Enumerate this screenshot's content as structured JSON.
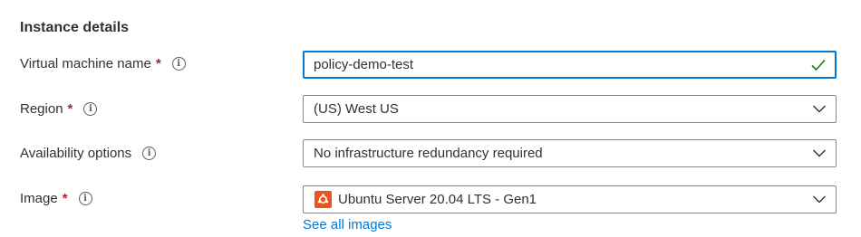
{
  "section": {
    "title": "Instance details"
  },
  "fields": {
    "vm_name": {
      "label": "Virtual machine name",
      "required_mark": "*",
      "value": "policy-demo-test"
    },
    "region": {
      "label": "Region",
      "required_mark": "*",
      "value": "(US) West US"
    },
    "availability": {
      "label": "Availability options",
      "value": "No infrastructure redundancy required"
    },
    "image": {
      "label": "Image",
      "required_mark": "*",
      "value": "Ubuntu Server 20.04 LTS - Gen1",
      "link": "See all images"
    }
  },
  "icons": {
    "info": "info-icon",
    "chevron": "chevron-down-icon",
    "valid": "checkmark-icon",
    "image_os": "ubuntu-icon"
  },
  "colors": {
    "accent": "#0078d4",
    "required": "#a4262c",
    "valid": "#107c10",
    "ubuntu": "#e95420",
    "border": "#8a8886"
  }
}
